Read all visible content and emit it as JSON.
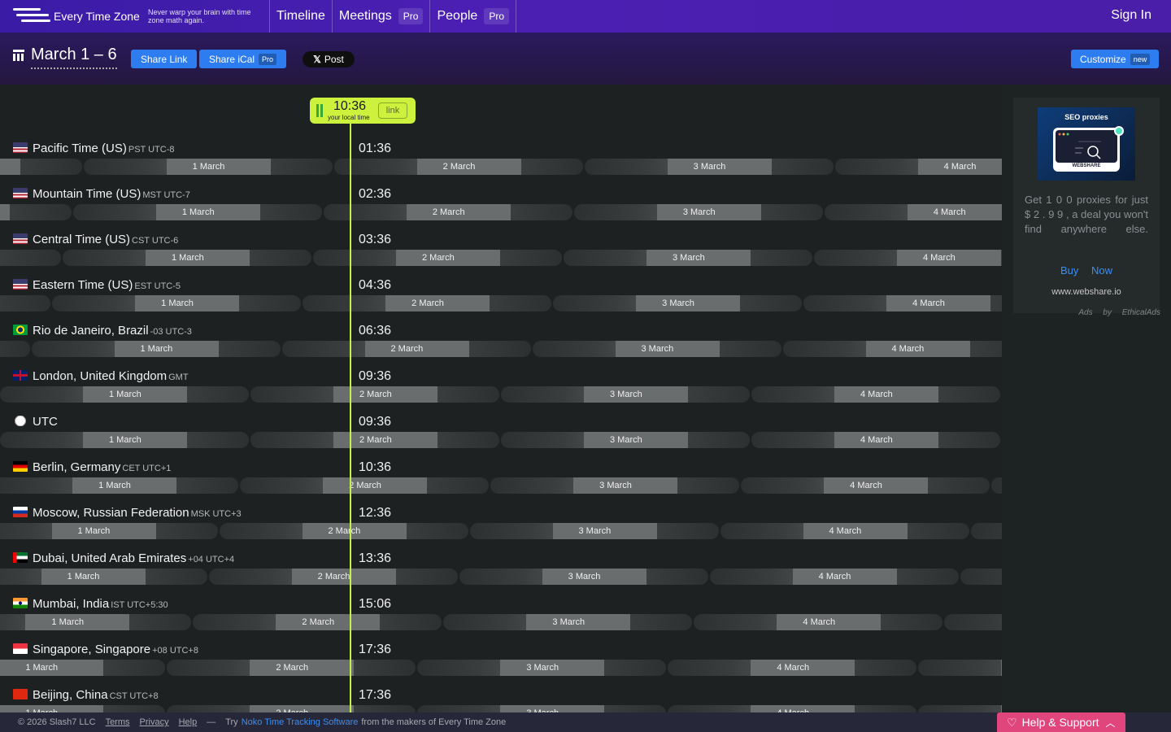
{
  "header": {
    "brand": "Every Time Zone",
    "tagline": "Never warp your brain with time zone math again.",
    "nav": [
      {
        "label": "Timeline",
        "badge": ""
      },
      {
        "label": "Meetings",
        "badge": "Pro"
      },
      {
        "label": "People",
        "badge": "Pro"
      }
    ],
    "sign_in": "Sign In"
  },
  "subheader": {
    "date_range": "March 1 – 6",
    "share_link": "Share Link",
    "share_ical": "Share iCal",
    "share_ical_badge": "Pro",
    "post": "Post",
    "post_glyph": "𝕏",
    "customize": "Customize",
    "customize_badge": "new"
  },
  "now": {
    "time": "10:36",
    "caption": "your local time",
    "link": "link"
  },
  "zones": [
    {
      "name": "Pacific Time (US)",
      "abbr": "PST UTC-8",
      "time": "01:36",
      "flag": "us"
    },
    {
      "name": "Mountain Time (US)",
      "abbr": "MST UTC-7",
      "time": "02:36",
      "flag": "us"
    },
    {
      "name": "Central Time (US)",
      "abbr": "CST UTC-6",
      "time": "03:36",
      "flag": "us"
    },
    {
      "name": "Eastern Time (US)",
      "abbr": "EST UTC-5",
      "time": "04:36",
      "flag": "us"
    },
    {
      "name": "Rio de Janeiro, Brazil",
      "abbr": "-03 UTC-3",
      "time": "06:36",
      "flag": "br"
    },
    {
      "name": "London, United Kingdom",
      "abbr": "GMT",
      "time": "09:36",
      "flag": "gb"
    },
    {
      "name": "UTC",
      "abbr": "",
      "time": "09:36",
      "flag": "clock"
    },
    {
      "name": "Berlin, Germany",
      "abbr": "CET UTC+1",
      "time": "10:36",
      "flag": "de"
    },
    {
      "name": "Moscow, Russian Federation",
      "abbr": "MSK UTC+3",
      "time": "12:36",
      "flag": "ru"
    },
    {
      "name": "Dubai, United Arab Emirates",
      "abbr": "+04 UTC+4",
      "time": "13:36",
      "flag": "ae"
    },
    {
      "name": "Mumbai, India",
      "abbr": "IST UTC+5:30",
      "time": "15:06",
      "flag": "in"
    },
    {
      "name": "Singapore, Singapore",
      "abbr": "+08 UTC+8",
      "time": "17:36",
      "flag": "sg"
    },
    {
      "name": "Beijing, China",
      "abbr": "CST UTC+8",
      "time": "17:36",
      "flag": "cn"
    }
  ],
  "day_labels": [
    "1 March",
    "2 March",
    "3 March",
    "4 March"
  ],
  "utc_offsets_hours": [
    -8,
    -7,
    -6,
    -5,
    -3,
    0,
    0,
    1,
    3,
    4,
    5.5,
    8,
    8
  ],
  "ad": {
    "image_title": "SEO proxies",
    "image_brand": "WEBSHARE",
    "text": "Get 1 0 0 proxies for just $ 2 . 9 9 , a deal you won't find anywhere else.",
    "cta": "Buy Now",
    "domain": "www.webshare.io",
    "attribution": "Ads by EthicalAds"
  },
  "footer": {
    "copyright": "© 2026 Slash7 LLC",
    "terms": "Terms",
    "privacy": "Privacy",
    "help": "Help",
    "sep": "—",
    "try_prefix": "Try",
    "noko": "Noko Time Tracking Software",
    "try_suffix": "from the makers of Every Time Zone"
  },
  "help_button": {
    "label": "Help & Support"
  },
  "colors": {
    "accent_green": "#cdf23d",
    "brand_purple": "#4b1fb3",
    "button_blue": "#2e7df0",
    "help_pink": "#e0457b"
  }
}
